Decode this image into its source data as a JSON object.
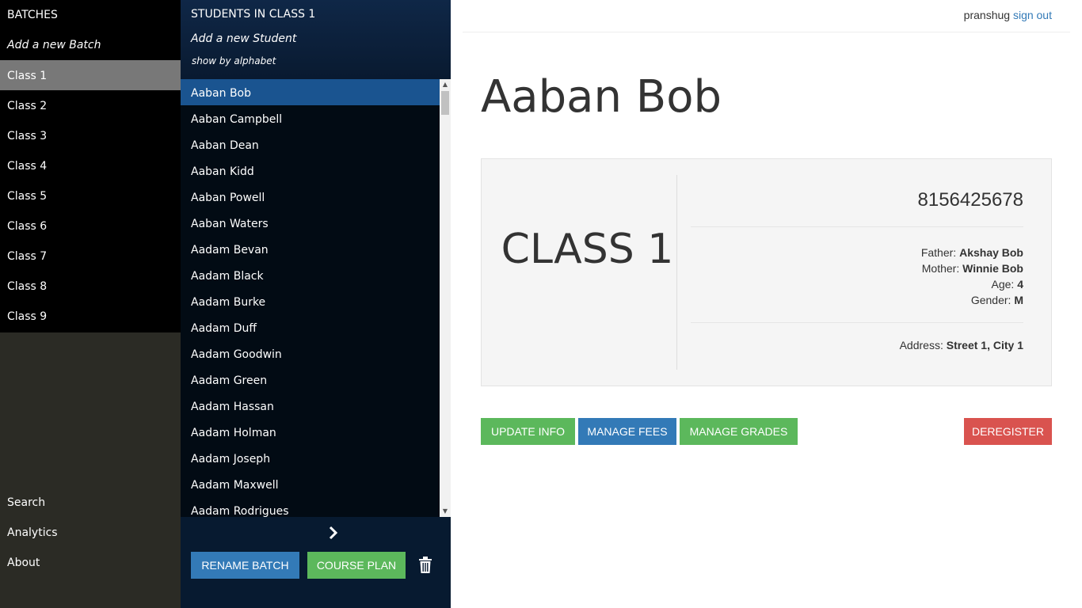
{
  "batches": {
    "title": "BATCHES",
    "add_label": "Add a new Batch",
    "items": [
      {
        "label": "Class 1"
      },
      {
        "label": "Class 2"
      },
      {
        "label": "Class 3"
      },
      {
        "label": "Class 4"
      },
      {
        "label": "Class 5"
      },
      {
        "label": "Class 6"
      },
      {
        "label": "Class 7"
      },
      {
        "label": "Class 8"
      },
      {
        "label": "Class 9"
      }
    ],
    "active_index": 0,
    "bottom_links": {
      "search": "Search",
      "analytics": "Analytics",
      "about": "About"
    }
  },
  "students": {
    "title": "STUDENTS IN CLASS 1",
    "add_label": "Add a new Student",
    "alphabet_label": "show by alphabet",
    "items": [
      "Aaban Bob",
      "Aaban Campbell",
      "Aaban Dean",
      "Aaban Kidd",
      "Aaban Powell",
      "Aaban Waters",
      "Aadam Bevan",
      "Aadam Black",
      "Aadam Burke",
      "Aadam Duff",
      "Aadam Goodwin",
      "Aadam Green",
      "Aadam Hassan",
      "Aadam Holman",
      "Aadam Joseph",
      "Aadam Maxwell",
      "Aadam Rodrigues"
    ],
    "active_index": 0,
    "footer": {
      "next_icon": "chevron-right-icon",
      "rename_label": "RENAME BATCH",
      "course_label": "COURSE PLAN",
      "trash_icon": "trash-icon"
    }
  },
  "header": {
    "username": "pranshug",
    "signout_label": "sign out"
  },
  "student": {
    "name": "Aaban Bob",
    "class_label": "CLASS 1",
    "phone": "8156425678",
    "father_label": "Father:",
    "father": "Akshay Bob",
    "mother_label": "Mother:",
    "mother": "Winnie Bob",
    "age_label": "Age:",
    "age": "4",
    "gender_label": "Gender:",
    "gender": "M",
    "address_label": "Address:",
    "address": "Street 1, City 1"
  },
  "actions": {
    "update_label": "UPDATE INFO",
    "fees_label": "MANAGE FEES",
    "grades_label": "MANAGE GRADES",
    "deregister_label": "DEREGISTER"
  },
  "colors": {
    "primary": "#337ab7",
    "success": "#5cb85c",
    "danger": "#d9534f",
    "active_batch": "#787878",
    "active_student": "#1a5490"
  }
}
